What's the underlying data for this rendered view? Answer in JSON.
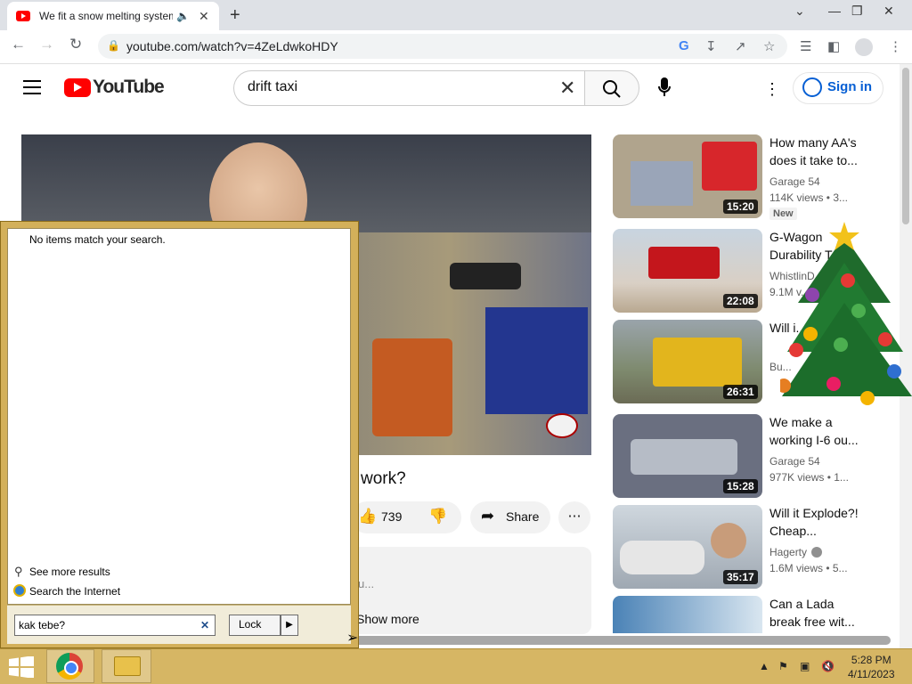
{
  "browser": {
    "tab_title": "We fit a snow melting system",
    "tab_audio_icon": "speaker-icon",
    "url": "youtube.com/watch?v=4ZeLdwkoHDY"
  },
  "youtube": {
    "logo_text": "YouTube",
    "search_value": "drift taxi",
    "signin_label": "Sign in"
  },
  "video": {
    "title_fragment": "work?",
    "likes": "739",
    "share_label": "Share",
    "description_fragment": "u...",
    "show_more": "Show more"
  },
  "recommended": [
    {
      "title": "How many AA's does it take to...",
      "channel": "Garage 54",
      "meta": "114K views  • 3...",
      "duration": "15:20",
      "badge": "New",
      "thumb_color": "#b0a48d"
    },
    {
      "title": "G-Wagon Durability T...",
      "channel": "WhistlinD...",
      "meta": "9.1M v...",
      "duration": "22:08",
      "thumb_color": "#c8d4e0"
    },
    {
      "title": "Will i... FOR...",
      "channel": "Bu...",
      "meta": "",
      "duration": "26:31",
      "thumb_color": "#8a8f76"
    },
    {
      "title": "We make a working I-6 ou...",
      "channel": "Garage 54",
      "meta": "977K views  • 1...",
      "duration": "15:28",
      "thumb_color": "#6a6f80"
    },
    {
      "title": "Will it Explode?! Cheap...",
      "channel": "Hagerty",
      "meta": "1.6M views  • 5...",
      "duration": "35:17",
      "thumb_color": "#9fa8b2"
    },
    {
      "title": "Can a Lada break free wit...",
      "channel": "",
      "meta": "",
      "duration": "",
      "thumb_color": "#4a82b6"
    }
  ],
  "start_menu": {
    "no_items": "No items match your search.",
    "see_more": "See more results",
    "search_internet": "Search the Internet",
    "search_value": "kak tebe?",
    "lock_label": "Lock"
  },
  "taskbar": {
    "time": "5:28 PM",
    "date": "4/11/2023"
  }
}
